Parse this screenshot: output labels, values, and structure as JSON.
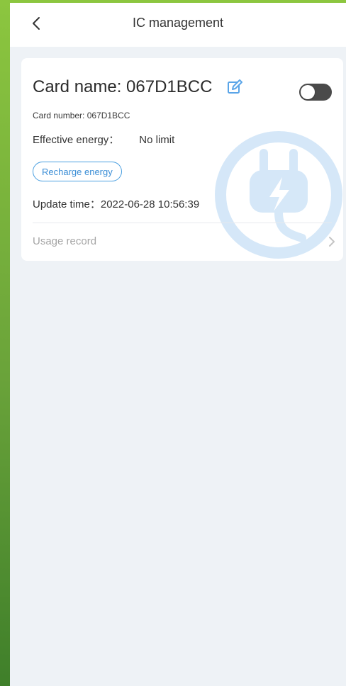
{
  "header": {
    "title": "IC management",
    "back_icon": "chevron-left-icon"
  },
  "card": {
    "name_label": "Card name: 067D1BCC",
    "number_label": "Card number: 067D1BCC",
    "effective_energy_label": "Effective energy：",
    "effective_energy_value": "No limit",
    "recharge_button": "Recharge energy",
    "update_label": "Update time：",
    "update_value": "2022-06-28 10:56:39",
    "usage_record_label": "Usage record",
    "toggle_state": "off",
    "icons": [
      "edit-icon",
      "toggle-switch",
      "charging-plug-watermark-icon",
      "chevron-right-icon"
    ]
  },
  "colors": {
    "accent": "#3b8ed6",
    "toggle_off": "#4a4a4a",
    "page_background": "#eef2f6",
    "outer_background": "#8cc63f"
  }
}
